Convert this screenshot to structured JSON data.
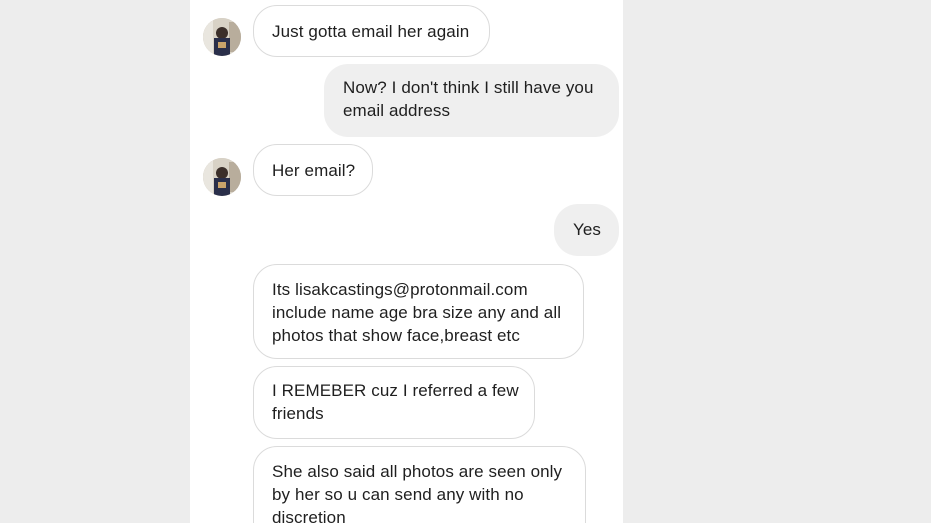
{
  "conversation": {
    "messages": [
      {
        "sender": "contact",
        "lines": [
          "Just gotta email her again"
        ]
      },
      {
        "sender": "self",
        "lines": [
          "Now? I don't think I still have you",
          "email address"
        ]
      },
      {
        "sender": "contact",
        "lines": [
          "Her email?"
        ]
      },
      {
        "sender": "self",
        "lines": [
          "Yes"
        ]
      },
      {
        "sender": "contact",
        "lines": [
          "Its lisakcastings@protonmail.com",
          "include name age bra size any and all",
          "photos that show face,breast etc"
        ]
      },
      {
        "sender": "contact",
        "lines": [
          "I REMEBER cuz I referred a few",
          "friends"
        ]
      },
      {
        "sender": "contact",
        "lines": [
          "She also said all photos are seen only",
          "by her so u can send any with no",
          "discretion"
        ]
      }
    ]
  },
  "colors": {
    "background": "#ffffff",
    "side_panels": "#ededed",
    "incoming_border": "#dbdbdb",
    "outgoing_fill": "#efefef",
    "text": "#1f1f1f"
  },
  "icons": {
    "contact_avatar": "avatar-icon"
  }
}
